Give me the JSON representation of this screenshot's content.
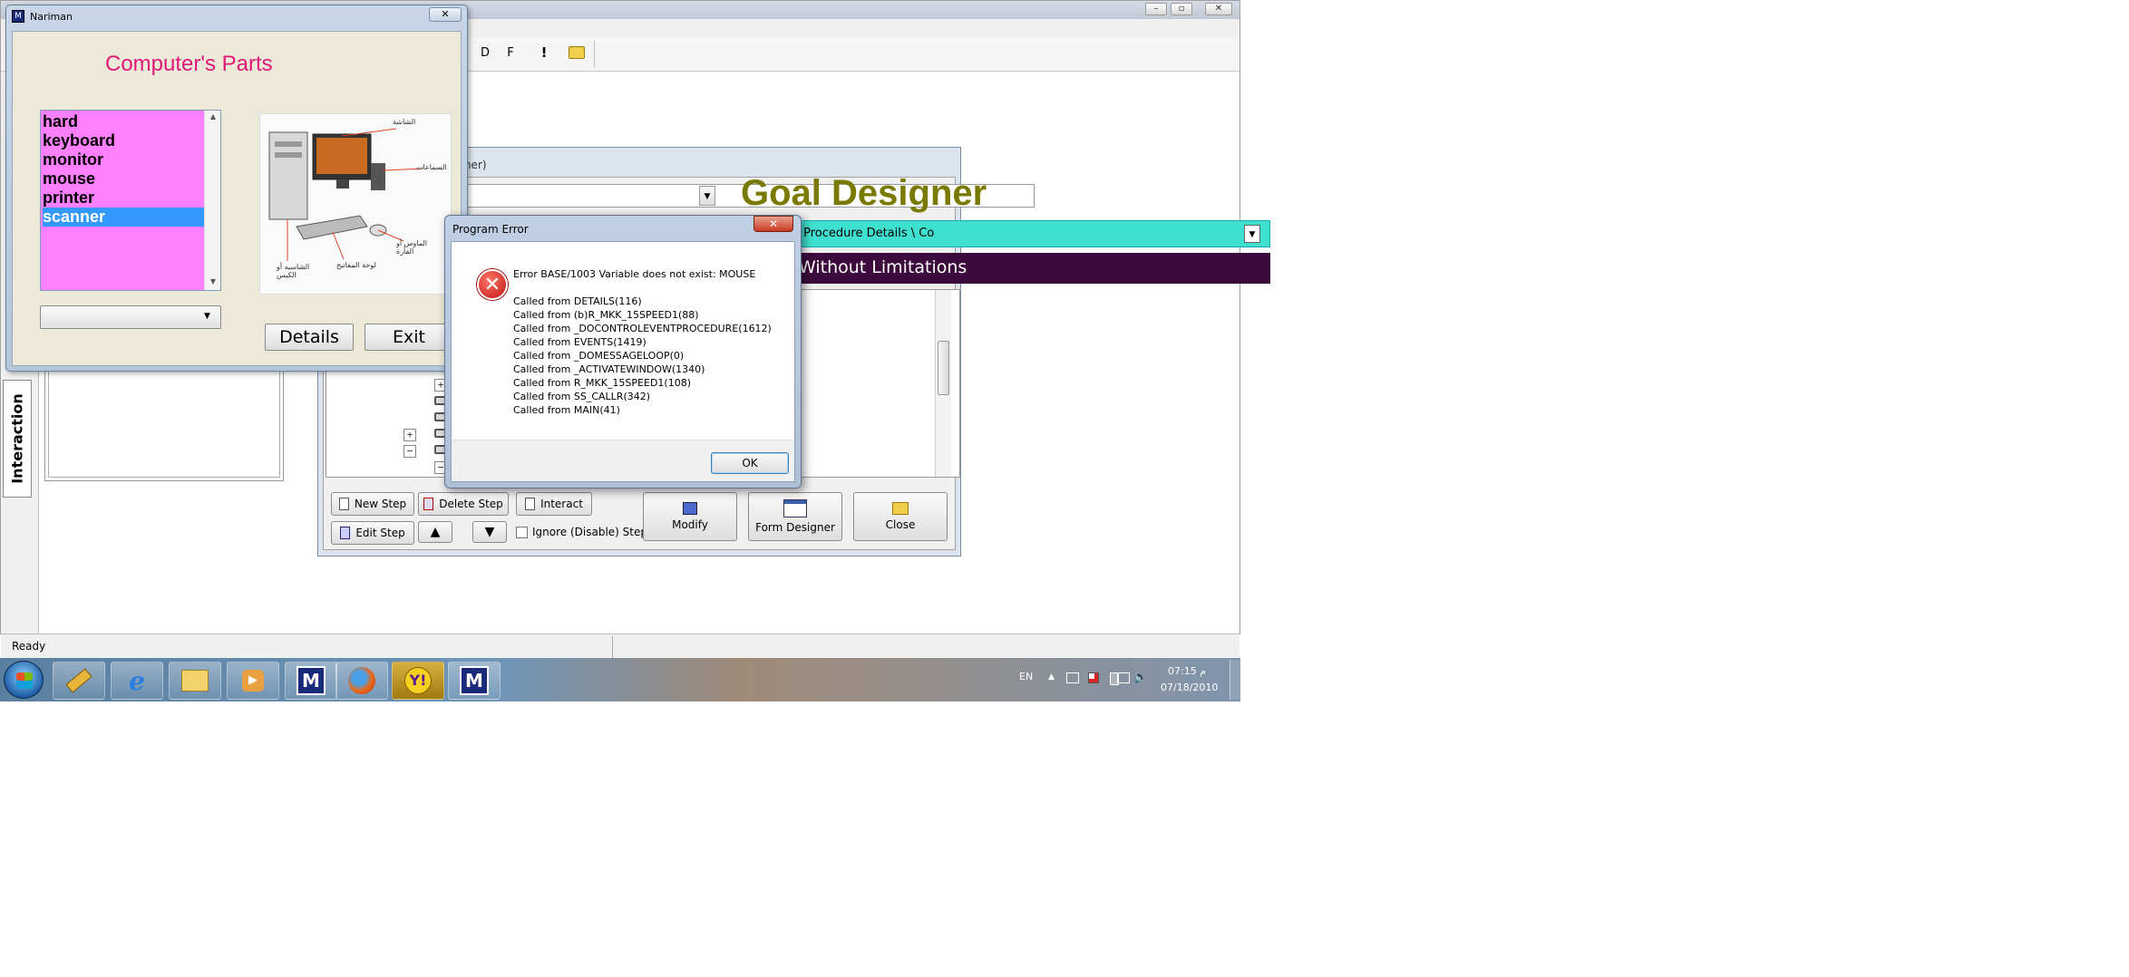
{
  "main_window": {
    "toolbar_buttons": [
      "D",
      "F",
      "!"
    ],
    "status_text": "Ready",
    "side_tab_label": "Interaction"
  },
  "designer": {
    "title_fragment": "igner)",
    "brand_title": "Goal Designer",
    "breadcrumb": "e Procedure Details  \\  Co",
    "banner": "Without Limitations",
    "buttons": {
      "new_step": "New Step",
      "delete_step": "Delete Step",
      "interact": "Interact",
      "edit_step": "Edit Step",
      "ignore_step": "Ignore (Disable) Step",
      "modify": "Modify",
      "form_designer": "Form Designer",
      "close": "Close"
    }
  },
  "nariman": {
    "title": "Nariman",
    "heading": "Computer's Parts",
    "list_items": [
      "hard",
      "keyboard",
      "monitor",
      "mouse",
      "printer",
      "scanner"
    ],
    "selected_item": "scanner",
    "image_labels": [
      "الشاشة",
      "السماعات",
      "الماوس أو الفأرة",
      "لوحة المفاتيح",
      "الشاسيه أو الكيس"
    ],
    "details_button": "Details",
    "exit_button": "Exit"
  },
  "error_dialog": {
    "title": "Program Error",
    "message": "Error BASE/1003  Variable does not exist: MOUSE",
    "call_stack": [
      "Called from DETAILS(116)",
      "Called from (b)R_MKK_15SPEED1(88)",
      "Called from _DOCONTROLEVENTPROCEDURE(1612)",
      "Called from EVENTS(1419)",
      "Called from _DOMESSAGELOOP(0)",
      "Called from _ACTIVATEWINDOW(1340)",
      "Called from R_MKK_15SPEED1(108)",
      "Called from SS_CALLR(342)",
      "Called from MAIN(41)"
    ],
    "ok_label": "OK"
  },
  "taskbar": {
    "language": "EN",
    "time": "07:15 م",
    "date": "07/18/2010"
  },
  "colors": {
    "accent_pink": "#e01878",
    "list_bg": "#ff80ff",
    "selection": "#3399ff",
    "goal_olive": "#7a7a00",
    "banner_purple": "#3c0a3c",
    "breadcrumb_cyan": "#40e0d0"
  }
}
